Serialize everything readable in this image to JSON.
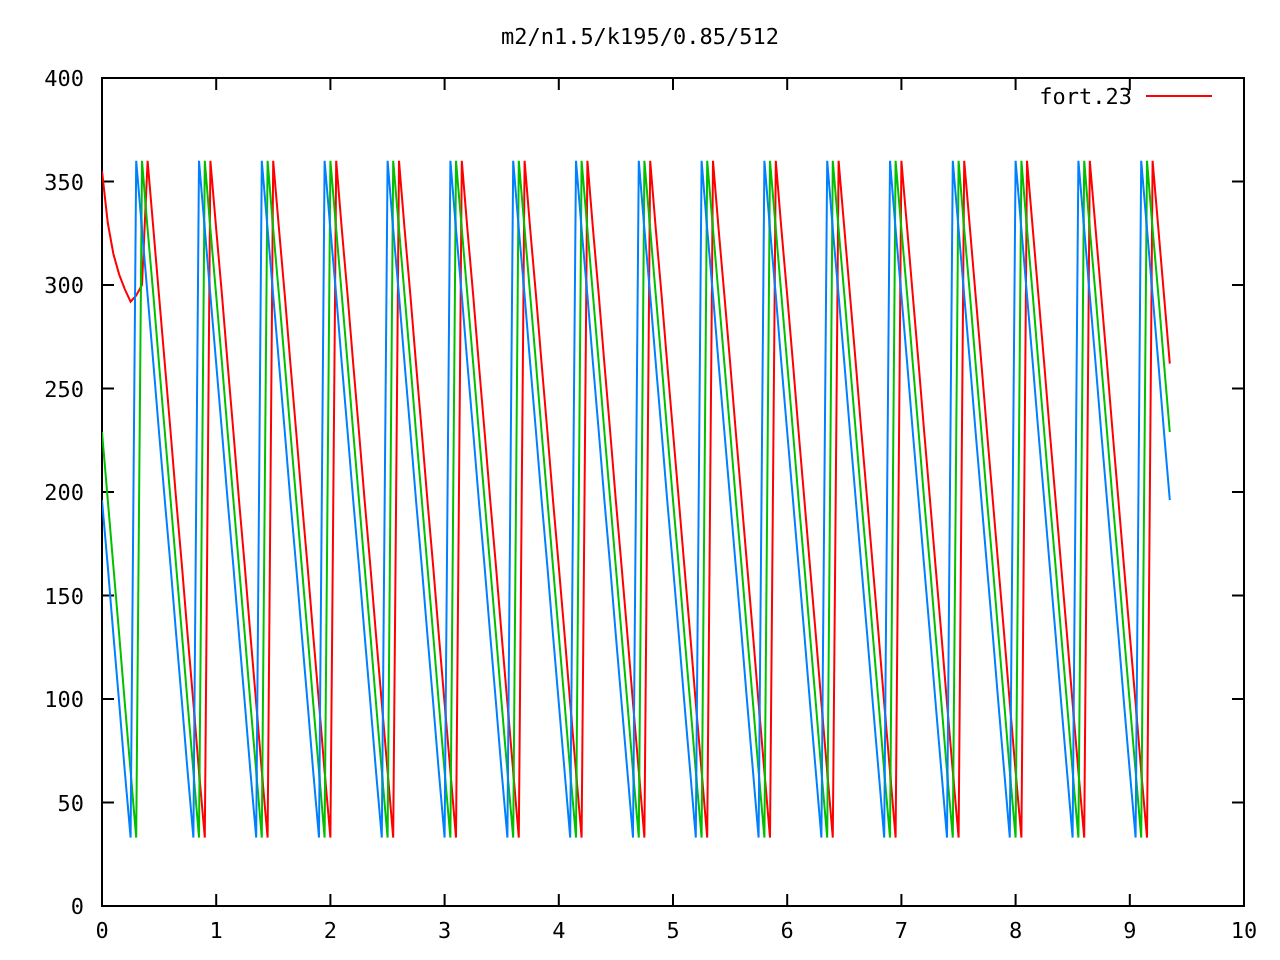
{
  "plot": {
    "chart_data": {
      "type": "line",
      "title": "m2/n1.5/k195/0.85/512",
      "xlim": [
        0,
        10
      ],
      "ylim": [
        0,
        400
      ],
      "xticks": [
        0,
        1,
        2,
        3,
        4,
        5,
        6,
        7,
        8,
        9,
        10
      ],
      "yticks": [
        0,
        50,
        100,
        150,
        200,
        250,
        300,
        350,
        400
      ],
      "x": [
        0,
        0.05,
        0.1,
        0.15,
        0.2,
        0.25,
        0.3,
        0.35,
        0.4,
        0.45,
        0.5,
        0.55,
        0.6,
        0.65,
        0.7,
        0.75,
        0.8,
        0.85,
        0.9,
        0.95,
        1,
        1.05,
        1.1,
        1.15,
        1.2,
        1.25,
        1.3,
        1.35,
        1.4,
        1.45,
        1.5,
        1.55,
        1.6,
        1.65,
        1.7,
        1.75,
        1.8,
        1.85,
        1.9,
        1.95,
        2,
        2.05,
        2.1,
        2.15,
        2.2,
        2.25,
        2.3,
        2.35,
        2.4,
        2.45,
        2.5,
        2.55,
        2.6,
        2.65,
        2.7,
        2.75,
        2.8,
        2.85,
        2.9,
        2.95,
        3,
        3.05,
        3.1,
        3.15,
        3.2,
        3.25,
        3.3,
        3.35,
        3.4,
        3.45,
        3.5,
        3.55,
        3.6,
        3.65,
        3.7,
        3.75,
        3.8,
        3.85,
        3.9,
        3.95,
        4,
        4.05,
        4.1,
        4.15,
        4.2,
        4.25,
        4.3,
        4.35,
        4.4,
        4.45,
        4.5,
        4.55,
        4.6,
        4.65,
        4.7,
        4.75,
        4.8,
        4.85,
        4.9,
        4.95,
        5,
        5.05,
        5.1,
        5.15,
        5.2,
        5.25,
        5.3,
        5.35,
        5.4,
        5.45,
        5.5,
        5.55,
        5.6,
        5.65,
        5.7,
        5.75,
        5.8,
        5.85,
        5.9,
        5.95,
        6,
        6.05,
        6.1,
        6.15,
        6.2,
        6.25,
        6.3,
        6.35,
        6.4,
        6.45,
        6.5,
        6.55,
        6.6,
        6.65,
        6.7,
        6.75,
        6.8,
        6.85,
        6.9,
        6.95,
        7,
        7.05,
        7.1,
        7.15,
        7.2,
        7.25,
        7.3,
        7.35,
        7.4,
        7.45,
        7.5,
        7.55,
        7.6,
        7.65,
        7.7,
        7.75,
        7.8,
        7.85,
        7.9,
        7.95,
        8,
        8.05,
        8.1,
        8.15,
        8.2,
        8.25,
        8.3,
        8.35,
        8.4,
        8.45,
        8.5,
        8.55,
        8.6,
        8.65,
        8.7,
        8.75,
        8.8,
        8.85,
        8.9,
        8.95,
        9,
        9.05,
        9.1,
        9.15,
        9.2,
        9.25,
        9.3,
        9.35
      ],
      "series": [
        {
          "name": "fort.23",
          "color": "#ff0000",
          "values": [
            355,
            330,
            315,
            305,
            298,
            292,
            295,
            300,
            360,
            327,
            295,
            262,
            229,
            196,
            164,
            131,
            98,
            65,
            33,
            360,
            327,
            295,
            262,
            229,
            196,
            164,
            131,
            98,
            65,
            33,
            360,
            327,
            295,
            262,
            229,
            196,
            164,
            131,
            98,
            65,
            33,
            360,
            327,
            295,
            262,
            229,
            196,
            164,
            131,
            98,
            65,
            33,
            360,
            327,
            295,
            262,
            229,
            196,
            164,
            131,
            98,
            65,
            33,
            360,
            327,
            295,
            262,
            229,
            196,
            164,
            131,
            98,
            65,
            33,
            360,
            327,
            295,
            262,
            229,
            196,
            164,
            131,
            98,
            65,
            33,
            360,
            327,
            295,
            262,
            229,
            196,
            164,
            131,
            98,
            65,
            33,
            360,
            327,
            295,
            262,
            229,
            196,
            164,
            131,
            98,
            65,
            33,
            360,
            327,
            295,
            262,
            229,
            196,
            164,
            131,
            98,
            65,
            33,
            360,
            327,
            295,
            262,
            229,
            196,
            164,
            131,
            98,
            65,
            33,
            360,
            327,
            295,
            262,
            229,
            196,
            164,
            131,
            98,
            65,
            33,
            360,
            327,
            295,
            262,
            229,
            196,
            164,
            131,
            98,
            65,
            33,
            360,
            327,
            295,
            262,
            229,
            196,
            164,
            131,
            98,
            65,
            33,
            360,
            327,
            295,
            262,
            229,
            196,
            164,
            131,
            98,
            65,
            33,
            360,
            327,
            295,
            262,
            229,
            196,
            164,
            131,
            98,
            65,
            33,
            360,
            327,
            295,
            262
          ]
        },
        {
          "color": "#00c000",
          "values": [
            229,
            196,
            164,
            131,
            98,
            65,
            33,
            360,
            327,
            295,
            262,
            229,
            196,
            164,
            131,
            98,
            65,
            33,
            360,
            327,
            295,
            262,
            229,
            196,
            164,
            131,
            98,
            65,
            33,
            360,
            327,
            295,
            262,
            229,
            196,
            164,
            131,
            98,
            65,
            33,
            360,
            327,
            295,
            262,
            229,
            196,
            164,
            131,
            98,
            65,
            33,
            360,
            327,
            295,
            262,
            229,
            196,
            164,
            131,
            98,
            65,
            33,
            360,
            327,
            295,
            262,
            229,
            196,
            164,
            131,
            98,
            65,
            33,
            360,
            327,
            295,
            262,
            229,
            196,
            164,
            131,
            98,
            65,
            33,
            360,
            327,
            295,
            262,
            229,
            196,
            164,
            131,
            98,
            65,
            33,
            360,
            327,
            295,
            262,
            229,
            196,
            164,
            131,
            98,
            65,
            33,
            360,
            327,
            295,
            262,
            229,
            196,
            164,
            131,
            98,
            65,
            33,
            360,
            327,
            295,
            262,
            229,
            196,
            164,
            131,
            98,
            65,
            33,
            360,
            327,
            295,
            262,
            229,
            196,
            164,
            131,
            98,
            65,
            33,
            360,
            327,
            295,
            262,
            229,
            196,
            164,
            131,
            98,
            65,
            33,
            360,
            327,
            295,
            262,
            229,
            196,
            164,
            131,
            98,
            65,
            33,
            360,
            327,
            295,
            262,
            229,
            196,
            164,
            131,
            98,
            65,
            33,
            360,
            327,
            295,
            262,
            229,
            196,
            164,
            131,
            98,
            65,
            33,
            360,
            327,
            295,
            262,
            229
          ]
        },
        {
          "color": "#0080ff",
          "values": [
            196,
            164,
            131,
            98,
            65,
            33,
            360,
            327,
            295,
            262,
            229,
            196,
            164,
            131,
            98,
            65,
            33,
            360,
            327,
            295,
            262,
            229,
            196,
            164,
            131,
            98,
            65,
            33,
            360,
            327,
            295,
            262,
            229,
            196,
            164,
            131,
            98,
            65,
            33,
            360,
            327,
            295,
            262,
            229,
            196,
            164,
            131,
            98,
            65,
            33,
            360,
            327,
            295,
            262,
            229,
            196,
            164,
            131,
            98,
            65,
            33,
            360,
            327,
            295,
            262,
            229,
            196,
            164,
            131,
            98,
            65,
            33,
            360,
            327,
            295,
            262,
            229,
            196,
            164,
            131,
            98,
            65,
            33,
            360,
            327,
            295,
            262,
            229,
            196,
            164,
            131,
            98,
            65,
            33,
            360,
            327,
            295,
            262,
            229,
            196,
            164,
            131,
            98,
            65,
            33,
            360,
            327,
            295,
            262,
            229,
            196,
            164,
            131,
            98,
            65,
            33,
            360,
            327,
            295,
            262,
            229,
            196,
            164,
            131,
            98,
            65,
            33,
            360,
            327,
            295,
            262,
            229,
            196,
            164,
            131,
            98,
            65,
            33,
            360,
            327,
            295,
            262,
            229,
            196,
            164,
            131,
            98,
            65,
            33,
            360,
            327,
            295,
            262,
            229,
            196,
            164,
            131,
            98,
            65,
            33,
            360,
            327,
            295,
            262,
            229,
            196,
            164,
            131,
            98,
            65,
            33,
            360,
            327,
            295,
            262,
            229,
            196,
            164,
            131,
            98,
            65,
            33,
            360,
            327,
            295,
            262,
            229,
            196
          ]
        }
      ]
    }
  }
}
